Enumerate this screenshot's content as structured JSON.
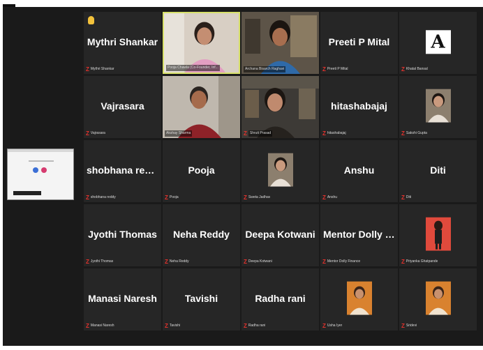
{
  "meeting": {
    "participants": [
      {
        "display_name": "Mythri Shankar",
        "label": "Mythri Shankar",
        "kind": "name",
        "muted": true,
        "raised_hand": true
      },
      {
        "display_name": "",
        "label": "Pooja Chawla (Co-Founder, Inf...",
        "kind": "video",
        "muted": false,
        "active_speaker": true
      },
      {
        "display_name": "",
        "label": "Archana Bisarch Raghavi",
        "kind": "video",
        "muted": false
      },
      {
        "display_name": "Preeti P Mital",
        "label": "Preeti P Mital",
        "kind": "name",
        "muted": true
      },
      {
        "display_name": "",
        "label": "Khatal Bansal",
        "kind": "logo",
        "logo_text": "A",
        "muted": true
      },
      {
        "display_name": "Vajrasara",
        "label": "Vajrasara",
        "kind": "name",
        "muted": true
      },
      {
        "display_name": "",
        "label": "Akshay Sharma",
        "kind": "video",
        "muted": false
      },
      {
        "display_name": "",
        "label": "Shruti Prasad",
        "kind": "video",
        "muted": true
      },
      {
        "display_name": "hitashabajaj",
        "label": "hitashabajaj",
        "kind": "name",
        "muted": true
      },
      {
        "display_name": "",
        "label": "Sakshi Gupta",
        "kind": "avatar",
        "muted": true
      },
      {
        "display_name": "shobhana reddy",
        "label": "shobhana reddy",
        "kind": "name",
        "muted": true
      },
      {
        "display_name": "Pooja",
        "label": "Pooja",
        "kind": "name",
        "muted": true
      },
      {
        "display_name": "",
        "label": "Sweta Jadhav",
        "kind": "avatar",
        "muted": true
      },
      {
        "display_name": "Anshu",
        "label": "Anshu",
        "kind": "name",
        "muted": true
      },
      {
        "display_name": "Diti",
        "label": "Diti",
        "kind": "name",
        "muted": true
      },
      {
        "display_name": "Jyothi Thomas",
        "label": "Jyothi Thomas",
        "kind": "name",
        "muted": true
      },
      {
        "display_name": "Neha Reddy",
        "label": "Neha Reddy",
        "kind": "name",
        "muted": true
      },
      {
        "display_name": "Deepa Kotwani",
        "label": "Deepa Kotwani",
        "kind": "name",
        "muted": true
      },
      {
        "display_name": "Mentor Dolly Fin...",
        "label": "Mentor Dolly Finance",
        "kind": "name",
        "muted": true
      },
      {
        "display_name": "",
        "label": "Priyanka Ghatpande",
        "kind": "avatar-red",
        "muted": true
      },
      {
        "display_name": "Manasi Naresh",
        "label": "Manasi Naresh",
        "kind": "name",
        "muted": true
      },
      {
        "display_name": "Tavishi",
        "label": "Tavishi",
        "kind": "name",
        "muted": true
      },
      {
        "display_name": "Radha rani",
        "label": "Radha rani",
        "kind": "name",
        "muted": true
      },
      {
        "display_name": "",
        "label": "Usha Iyer",
        "kind": "avatar-orange",
        "muted": true
      },
      {
        "display_name": "",
        "label": "Sridevi",
        "kind": "avatar-orange",
        "muted": true
      }
    ],
    "icons": {
      "muted": "mic-off-icon",
      "raised_hand": "raised-hand-icon"
    },
    "colors": {
      "background": "#1a1a1a",
      "tile": "#262626",
      "active_border": "#d7e06a",
      "muted_icon": "#e2312c",
      "raised_hand": "#f3c23b"
    }
  }
}
